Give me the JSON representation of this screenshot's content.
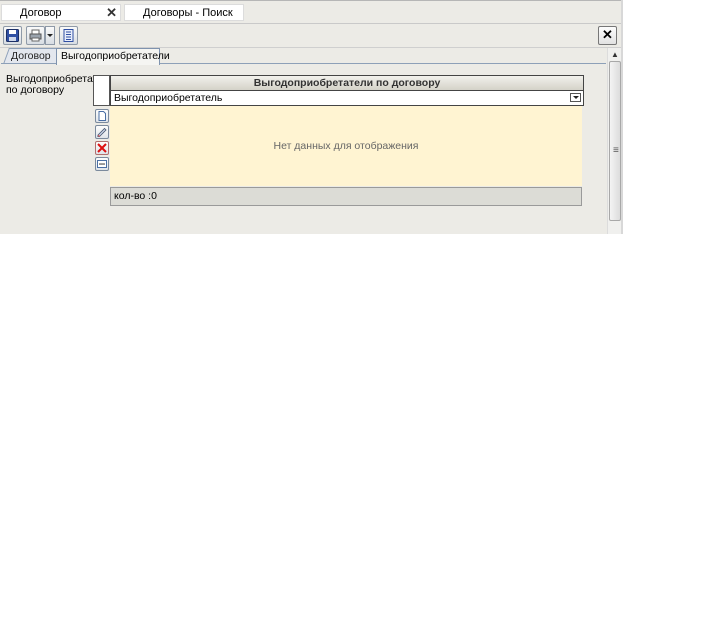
{
  "doc_tabs": [
    {
      "label": "Договор",
      "close": "✕"
    },
    {
      "label": "Договоры - Поиск"
    }
  ],
  "toolbar": {
    "close_label": "✕"
  },
  "form_tabs": [
    {
      "label": "Договор"
    },
    {
      "label": "Выгодоприобретатели"
    }
  ],
  "field_label": "Выгодоприобретатели по договору",
  "grid": {
    "band_title": "Выгодоприобретатели по договору",
    "column_header": "Выгодоприобретатель",
    "empty_text": "Нет данных для отображения",
    "count_text": "кол-во :0"
  },
  "icons": {
    "save": "floppy-disk-icon",
    "print": "printer-icon",
    "report": "document-icon",
    "new_row": "new-document-icon",
    "edit_row": "pencil-icon",
    "delete_row": "red-x-icon",
    "more": "ellipsis-icon"
  }
}
